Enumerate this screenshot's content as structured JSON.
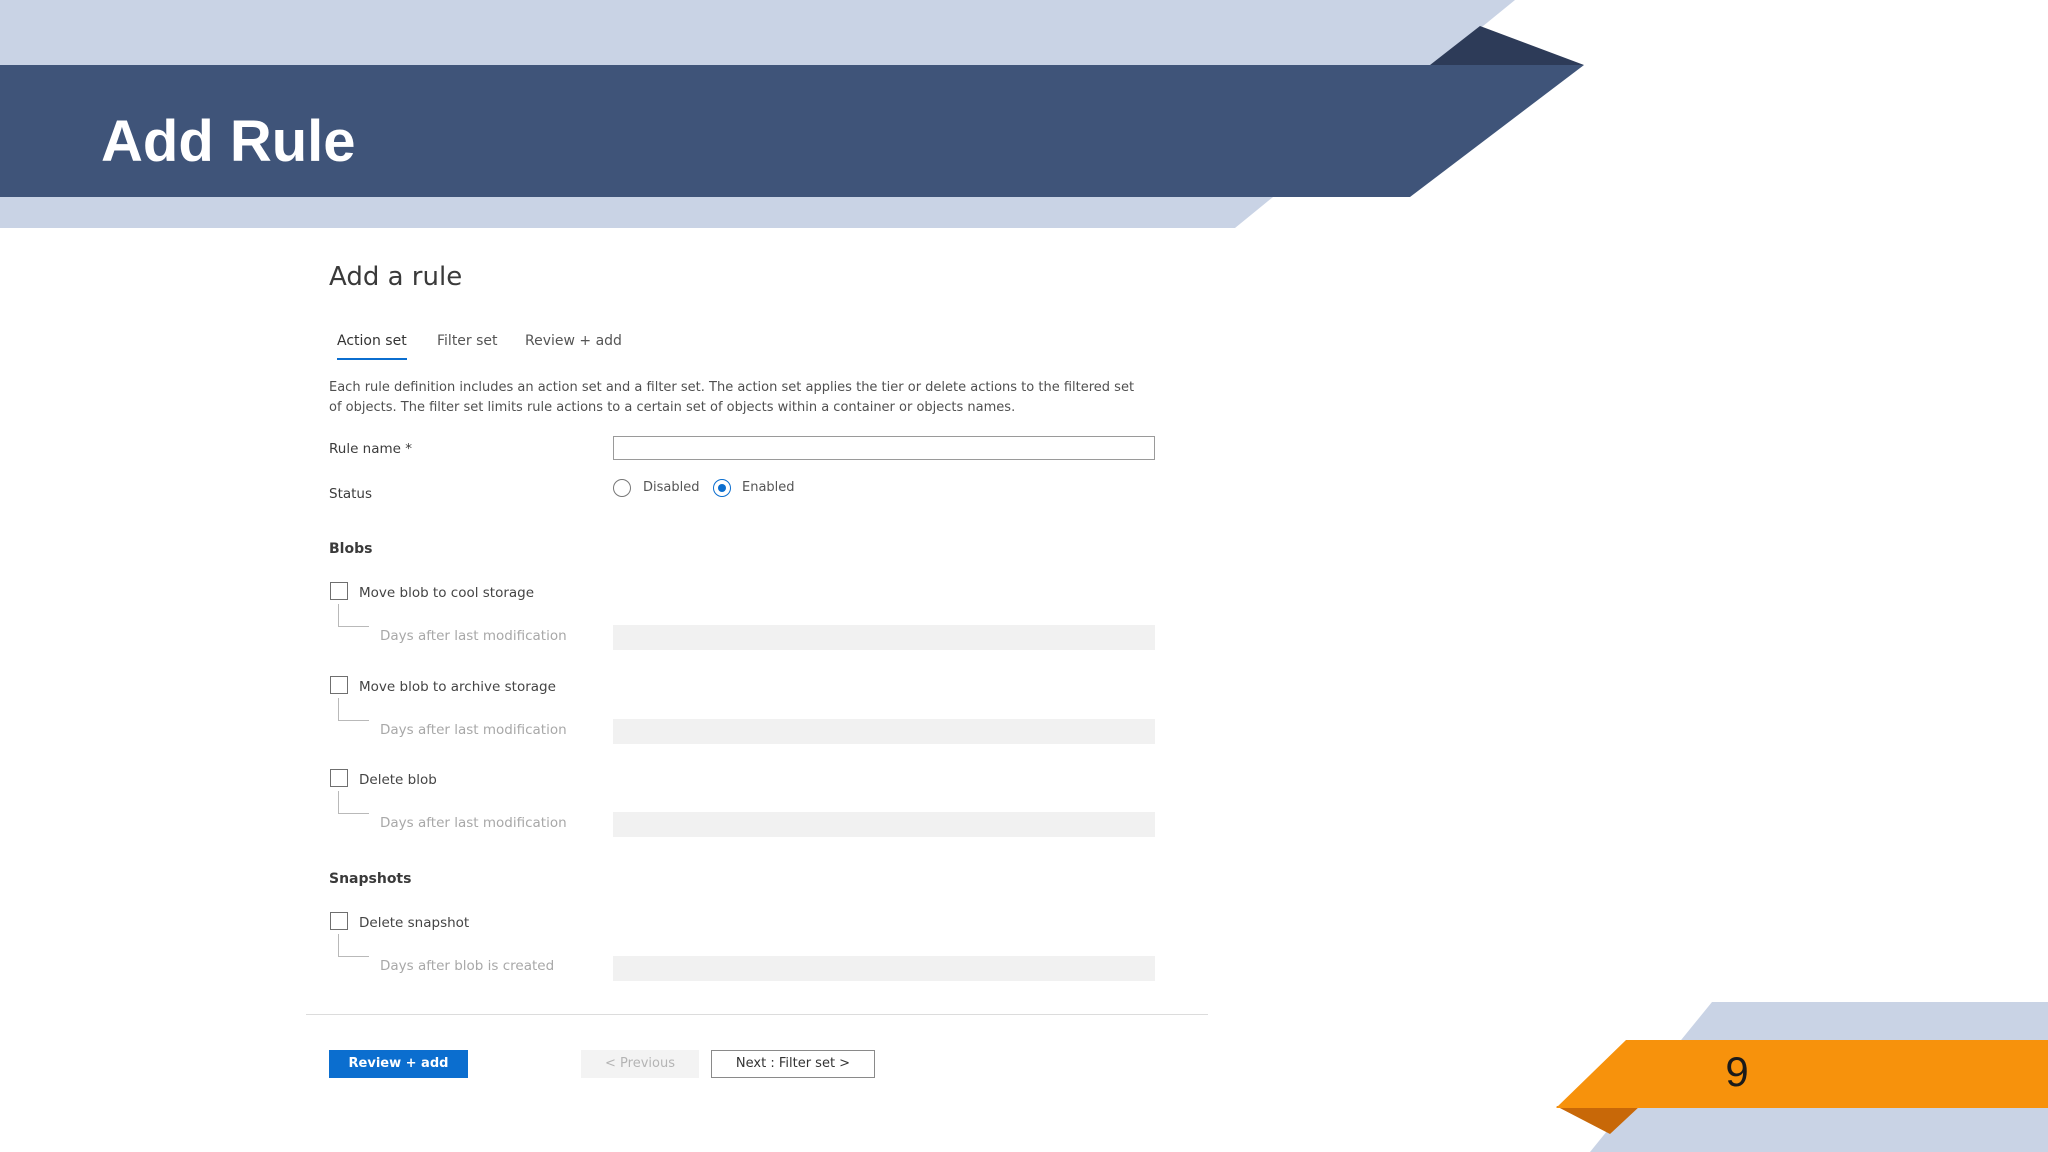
{
  "slide": {
    "title": "Add Rule",
    "page_number": "9",
    "colors": {
      "banner_dark": "#3f5479",
      "banner_light": "#c9d3e5",
      "banner_shadow": "#2d3b58",
      "accent_orange": "#f7920c",
      "accent_orange_dark": "#c86808"
    }
  },
  "panel": {
    "title": "Add a rule",
    "tabs": [
      {
        "label": "Action set",
        "active": true
      },
      {
        "label": "Filter set",
        "active": false
      },
      {
        "label": "Review + add",
        "active": false
      }
    ],
    "description": "Each rule definition includes an action set and a filter set. The action set applies the tier or delete actions to the filtered set of objects. The filter set limits rule actions to a certain set of objects within a container or objects names.",
    "rule_name": {
      "label": "Rule name *",
      "value": ""
    },
    "status": {
      "label": "Status",
      "options": [
        {
          "label": "Disabled",
          "selected": false
        },
        {
          "label": "Enabled",
          "selected": true
        }
      ]
    },
    "blobs": {
      "label": "Blobs",
      "items": [
        {
          "label": "Move blob to cool storage",
          "checked": false,
          "sub_label": "Days after last modification"
        },
        {
          "label": "Move blob to archive storage",
          "checked": false,
          "sub_label": "Days after last modification"
        },
        {
          "label": "Delete blob",
          "checked": false,
          "sub_label": "Days after last modification"
        }
      ]
    },
    "snapshots": {
      "label": "Snapshots",
      "items": [
        {
          "label": "Delete snapshot",
          "checked": false,
          "sub_label": "Days after blob is created"
        }
      ]
    },
    "footer": {
      "review_add": "Review + add",
      "previous": "< Previous",
      "next": "Next : Filter set >"
    },
    "colors": {
      "accent": "#0b6ecf"
    }
  }
}
